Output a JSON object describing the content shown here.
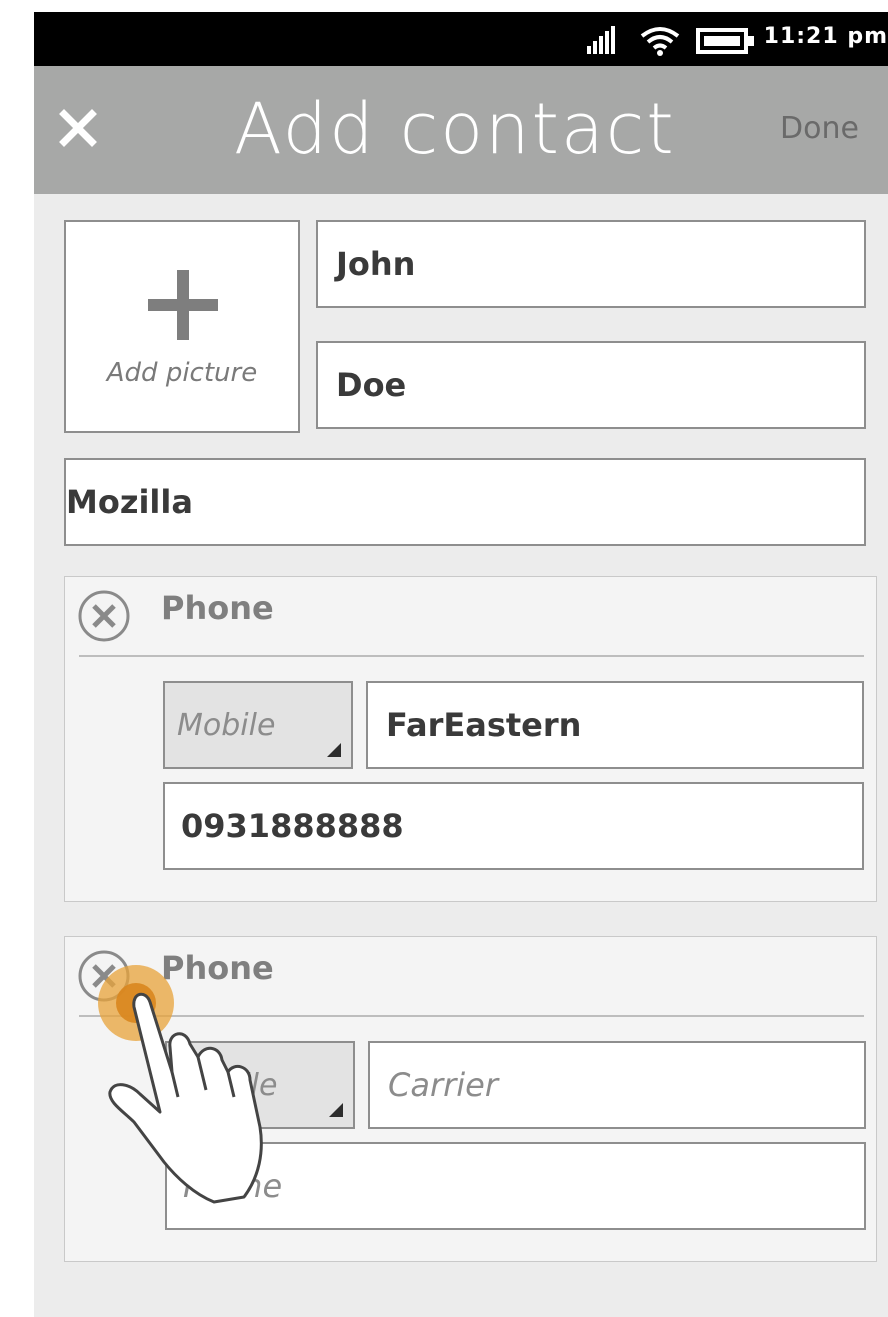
{
  "status_bar": {
    "time": "11:21 pm",
    "icons": [
      "signal-icon",
      "wifi-icon",
      "battery-icon"
    ]
  },
  "header": {
    "title": "Add contact",
    "done_label": "Done",
    "close_icon": "close-icon"
  },
  "form": {
    "add_picture_label": "Add picture",
    "first_name": "John",
    "last_name": "Doe",
    "company": "Mozilla"
  },
  "phones": [
    {
      "title": "Phone",
      "type": "Mobile",
      "carrier": "FarEastern",
      "number": "0931888888"
    },
    {
      "title": "Phone",
      "type_placeholder": "Mobile",
      "carrier_placeholder": "Carrier",
      "number_placeholder": "Phone"
    }
  ],
  "colors": {
    "header_bg": "#a7a8a7",
    "body_bg": "#ececec",
    "touch_accent": "#e8a33a"
  }
}
